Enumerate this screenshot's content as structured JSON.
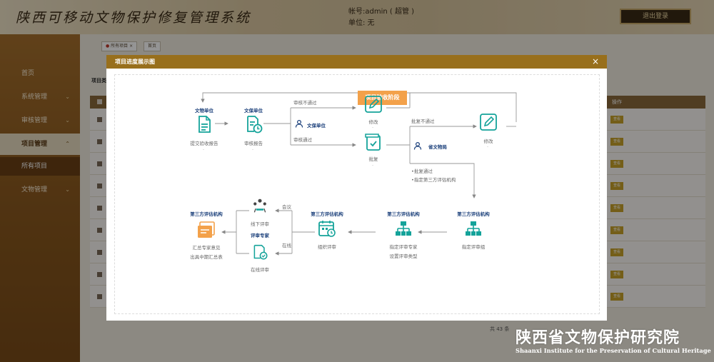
{
  "header": {
    "app_title": "陕西可移动文物保护修复管理系统",
    "account": "帐号:admin ( 超管 )",
    "unit": "单位:   无",
    "logout_label": "退出登录"
  },
  "sidebar": {
    "items": [
      {
        "label": "首页"
      },
      {
        "label": "系统管理"
      },
      {
        "label": "审核管理"
      },
      {
        "label": "项目管理"
      },
      {
        "label": "所有项目"
      },
      {
        "label": "文物管理"
      }
    ]
  },
  "tabs": [
    {
      "label": "所有项目",
      "close": "×"
    },
    {
      "label": "首页"
    }
  ],
  "main": {
    "panel_label": "项目类",
    "table_header_operation": "操作",
    "view_label": "查看",
    "pager_total": "共 43 条"
  },
  "modal": {
    "title": "项目进度展示图",
    "close": "×",
    "stage_label": "项目验收阶段",
    "actors": {
      "wenbao_1": "文物单位",
      "wenbao_2": "文保单位",
      "wenbao_3": "文保单位",
      "province": "省文物局",
      "third_1": "第三方评估机构",
      "third_2": "第三方评估机构",
      "third_3": "第三方评估机构",
      "third_4": "第三方评估机构",
      "expert": "评审专家"
    },
    "nodes": {
      "submit_report": "提交验收报告",
      "review_report": "审核报告",
      "modify_1": "修改",
      "approve": "批复",
      "modify_2": "修改",
      "designate_group": "指定评审组",
      "designate_expert": "指定评审专家",
      "set_review_type": "设置评审类型",
      "organize_review": "组织评审",
      "offline_review": "线下评审",
      "online_review": "在线评审",
      "summary_1": "汇总专家意见",
      "summary_2": "出具中期汇总表"
    },
    "edges": {
      "review_fail": "审核不通过",
      "review_pass": "审核通过",
      "approve_fail": "批复不通过",
      "approve_pass": "•批复通过",
      "designate_third": "•指定第三方评估机构",
      "meeting": "会议",
      "online": "在线"
    },
    "dot": "-"
  },
  "watermark": {
    "cn": "陕西省文物保护研究院",
    "en": "Shaanxi Institute for the Preservation of Cultural Heritage"
  },
  "colors": {
    "teal": "#14a39a",
    "orange": "#f3a14a",
    "brand_brown": "#986f1c",
    "actor_blue": "#1a3f7a"
  }
}
